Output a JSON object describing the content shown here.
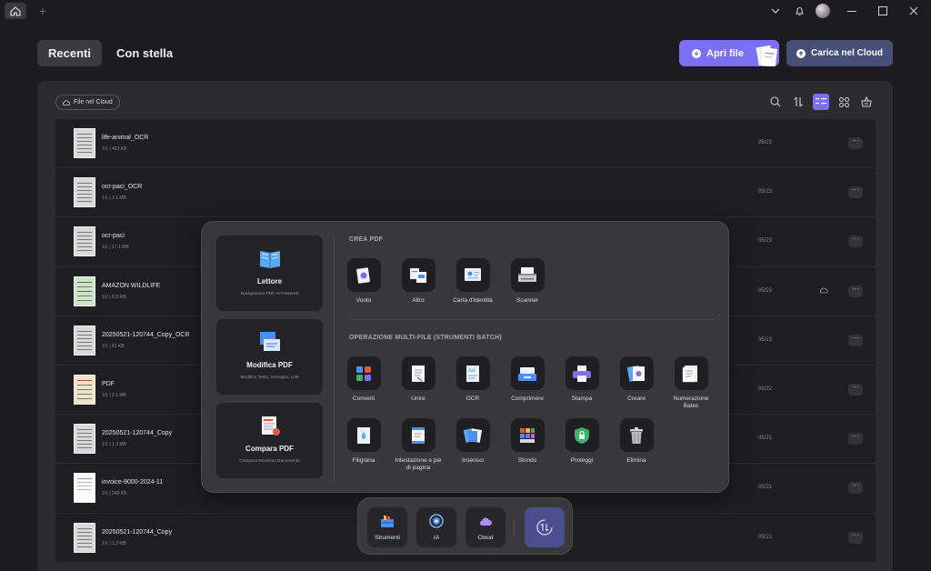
{
  "header": {
    "tab_recent": "Recenti",
    "tab_starred": "Con stella",
    "open_file": "Apri file",
    "upload_cloud": "Carica nel Cloud"
  },
  "toolbar": {
    "cloud_chip": "File nel Cloud"
  },
  "files": [
    {
      "name": "life-animal_OCR",
      "meta": "1/1 | 453 KB",
      "date": "05/23"
    },
    {
      "name": "ocr-paci_OCR",
      "meta": "1/1 | 1.1 MB",
      "date": "05/23"
    },
    {
      "name": "ocr-paci",
      "meta": "1/1 | 17.1 MB",
      "date": "05/23"
    },
    {
      "name": "AMAZON WILDLIFE",
      "meta": "1/2 | 6.8 MB",
      "date": "05/23"
    },
    {
      "name": "20250521-120744_Copy_OCR",
      "meta": "1/1 | 81 KB",
      "date": "05/23"
    },
    {
      "name": "PDF",
      "meta": "1/1 | 2.1 MB",
      "date": "05/22"
    },
    {
      "name": "20250521-120744_Copy",
      "meta": "1/1 | 1.3 MB",
      "date": "05/21"
    },
    {
      "name": "invoice-8000-2024-11",
      "meta": "1/1 | 249 KB",
      "date": "05/21"
    },
    {
      "name": "20250521-120744_Copy",
      "meta": "1/1 | 1.3 MB",
      "date": "05/21"
    }
  ],
  "popup": {
    "cards": [
      {
        "title": "Lettore",
        "sub": "Navigazione PDF AI-Powered"
      },
      {
        "title": "Modifica PDF",
        "sub": "Modifica Testo, Immagini, Link"
      },
      {
        "title": "Compara PDF",
        "sub": "Compara Revisioni Documento"
      }
    ],
    "create_title": "CREA PDF",
    "create": [
      "Vuoto",
      "Altro",
      "Carta d'identità",
      "Scanner"
    ],
    "batch_title": "OPERAZIONE MULTI-FILE (STRUMENTI BATCH)",
    "batch": [
      "Converti",
      "Unire",
      "OCR",
      "Comprimere",
      "Stampa",
      "Creare",
      "Numerazione Bates",
      "Filigrana",
      "Intestazione e piè di pagina",
      "Inserisci",
      "Sfondo",
      "Proteggi",
      "Elimina"
    ]
  },
  "dock": {
    "tools": "Strumenti",
    "ai": "IA",
    "cloud": "Cloud"
  },
  "colors": {
    "accent": "#7b6ff2",
    "cloud_button": "#464f77",
    "panel": "#2b2b2e"
  }
}
